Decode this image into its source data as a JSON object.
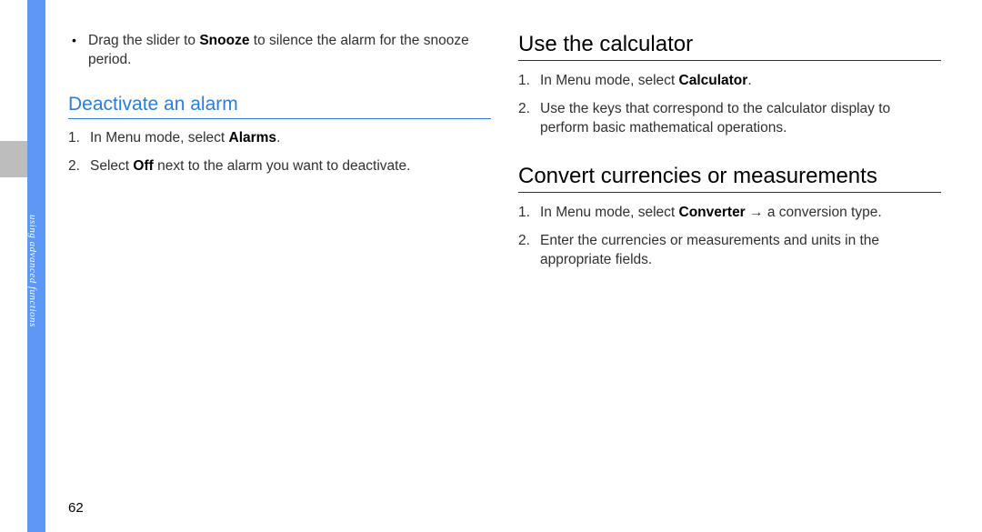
{
  "sidebar": {
    "vertical_label": "using advanced functions"
  },
  "page_number": "62",
  "left_column": {
    "bullet1_pre": "Drag the slider to ",
    "bullet1_bold": "Snooze",
    "bullet1_post": " to silence the alarm for the snooze period.",
    "heading_blue": "Deactivate an alarm",
    "step1_pre": "In Menu mode, select ",
    "step1_bold": "Alarms",
    "step1_post": ".",
    "step2_pre": "Select ",
    "step2_bold": "Off",
    "step2_post": " next to the alarm you want to deactivate."
  },
  "right_column": {
    "heading1": "Use the calculator",
    "r1_step1_pre": "In Menu mode, select ",
    "r1_step1_bold": "Calculator",
    "r1_step1_post": ".",
    "r1_step2": "Use the keys that correspond to the calculator display to perform basic mathematical operations.",
    "heading2": "Convert currencies or measurements",
    "r2_step1_pre": "In Menu mode, select ",
    "r2_step1_bold": "Converter",
    "r2_step1_post": " → a conversion type.",
    "r2_step2": "Enter the currencies or measurements and units in the appropriate fields."
  }
}
